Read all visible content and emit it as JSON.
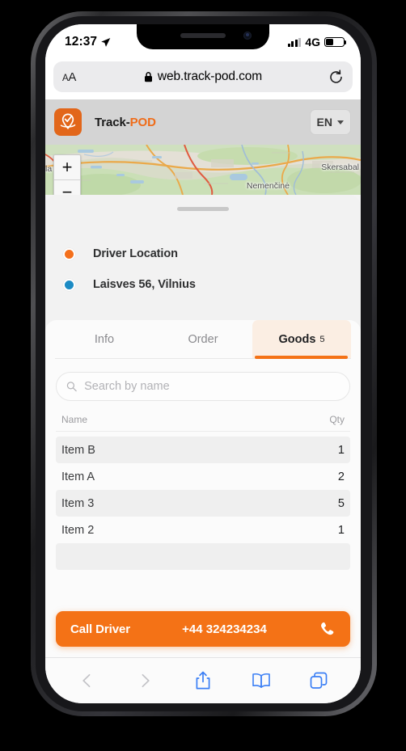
{
  "colors": {
    "brand_orange": "#f47216",
    "logo_orange": "#e2661a",
    "driver_dot": "#f4701c",
    "stop_dot": "#1c8bc4",
    "active_tab_bg": "#fbeee3",
    "safari_blue": "#3b7ff5",
    "app_header_bg": "#d4d4d4"
  },
  "status_bar": {
    "time": "12:37",
    "location_icon": "location-arrow-icon",
    "signal_icon": "cellular-signal-icon",
    "signal_bars_filled": 3,
    "signal_bars_total": 4,
    "network": "4G",
    "battery_icon": "battery-icon",
    "battery_percent": 42
  },
  "safari": {
    "text_size_label": "AA",
    "text_size_icon": "text-size-icon",
    "lock_icon": "lock-icon",
    "url": "web.track-pod.com",
    "reload_icon": "reload-icon",
    "toolbar": [
      {
        "name": "back-button",
        "icon": "chevron-left-icon",
        "enabled": false
      },
      {
        "name": "forward-button",
        "icon": "chevron-right-icon",
        "enabled": false
      },
      {
        "name": "share-button",
        "icon": "share-icon",
        "enabled": true
      },
      {
        "name": "bookmarks-button",
        "icon": "book-icon",
        "enabled": true
      },
      {
        "name": "tabs-button",
        "icon": "tabs-icon",
        "enabled": true
      }
    ]
  },
  "app_header": {
    "logo_icon": "track-pod-pin-check-logo",
    "brand_part1": "Track-",
    "brand_part2": "POD",
    "language": "EN",
    "language_caret_icon": "chevron-down-icon"
  },
  "map": {
    "zoom_in_label": "+",
    "zoom_out_label": "−",
    "labels": [
      {
        "text": "Skersabal",
        "name": "map-label-skersabal"
      },
      {
        "text": "Nemenčinė",
        "name": "map-label-nemencine"
      },
      {
        "text": "la",
        "name": "map-label-clipped"
      }
    ]
  },
  "sheet": {
    "drag_handle": "drag-handle",
    "locations": [
      {
        "label": "Driver Location",
        "dot_color": "#f4701c",
        "name": "location-row-driver"
      },
      {
        "label": "Laisves 56, Vilnius",
        "dot_color": "#1c8bc4",
        "name": "location-row-stop"
      }
    ]
  },
  "tabs": [
    {
      "label": "Info",
      "active": false,
      "badge": ""
    },
    {
      "label": "Order",
      "active": false,
      "badge": ""
    },
    {
      "label": "Goods",
      "active": true,
      "badge": "5"
    }
  ],
  "search": {
    "icon": "search-icon",
    "placeholder": "Search by name",
    "value": ""
  },
  "goods_table": {
    "columns": [
      "Name",
      "Qty"
    ],
    "rows": [
      {
        "name": "Item B",
        "qty": "1"
      },
      {
        "name": "Item A",
        "qty": "2"
      },
      {
        "name": "Item 3",
        "qty": "5"
      },
      {
        "name": "Item 2",
        "qty": "1"
      }
    ]
  },
  "call_driver": {
    "label": "Call Driver",
    "phone": "+44 324234234",
    "icon": "phone-icon"
  }
}
